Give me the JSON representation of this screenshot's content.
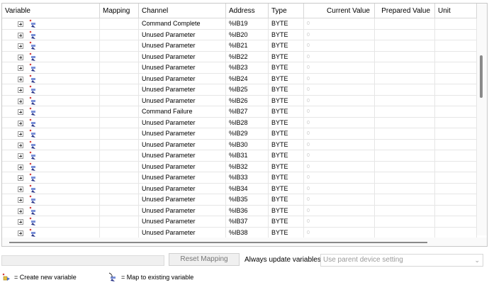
{
  "columns": {
    "variable": "Variable",
    "mapping": "Mapping",
    "channel": "Channel",
    "address": "Address",
    "type": "Type",
    "current_value": "Current Value",
    "prepared_value": "Prepared Value",
    "unit": "Unit"
  },
  "rows": [
    {
      "channel": "Command Complete",
      "address": "%IB19",
      "type": "BYTE",
      "current_value": "0"
    },
    {
      "channel": "Unused Parameter",
      "address": "%IB20",
      "type": "BYTE",
      "current_value": "0"
    },
    {
      "channel": "Unused Parameter",
      "address": "%IB21",
      "type": "BYTE",
      "current_value": "0"
    },
    {
      "channel": "Unused Parameter",
      "address": "%IB22",
      "type": "BYTE",
      "current_value": "0"
    },
    {
      "channel": "Unused Parameter",
      "address": "%IB23",
      "type": "BYTE",
      "current_value": "0"
    },
    {
      "channel": "Unused Parameter",
      "address": "%IB24",
      "type": "BYTE",
      "current_value": "0"
    },
    {
      "channel": "Unused Parameter",
      "address": "%IB25",
      "type": "BYTE",
      "current_value": "0"
    },
    {
      "channel": "Unused Parameter",
      "address": "%IB26",
      "type": "BYTE",
      "current_value": "0"
    },
    {
      "channel": "Command Failure",
      "address": "%IB27",
      "type": "BYTE",
      "current_value": "0"
    },
    {
      "channel": "Unused Parameter",
      "address": "%IB28",
      "type": "BYTE",
      "current_value": "0"
    },
    {
      "channel": "Unused Parameter",
      "address": "%IB29",
      "type": "BYTE",
      "current_value": "0"
    },
    {
      "channel": "Unused Parameter",
      "address": "%IB30",
      "type": "BYTE",
      "current_value": "0"
    },
    {
      "channel": "Unused Parameter",
      "address": "%IB31",
      "type": "BYTE",
      "current_value": "0"
    },
    {
      "channel": "Unused Parameter",
      "address": "%IB32",
      "type": "BYTE",
      "current_value": "0"
    },
    {
      "channel": "Unused Parameter",
      "address": "%IB33",
      "type": "BYTE",
      "current_value": "0"
    },
    {
      "channel": "Unused Parameter",
      "address": "%IB34",
      "type": "BYTE",
      "current_value": "0"
    },
    {
      "channel": "Unused Parameter",
      "address": "%IB35",
      "type": "BYTE",
      "current_value": "0"
    },
    {
      "channel": "Unused Parameter",
      "address": "%IB36",
      "type": "BYTE",
      "current_value": "0"
    },
    {
      "channel": "Unused Parameter",
      "address": "%IB37",
      "type": "BYTE",
      "current_value": "0"
    },
    {
      "channel": "Unused Parameter",
      "address": "%IB38",
      "type": "BYTE",
      "current_value": "0"
    }
  ],
  "bottom": {
    "reset_mapping_label": "Reset Mapping",
    "always_update_label": "Always update variables",
    "setting_value": "Use parent device setting"
  },
  "legend": {
    "create_new": "= Create new variable",
    "map_existing": "= Map to existing variable"
  },
  "icons": {
    "expand": "plus-box-icon",
    "row_variable": "variable-icon",
    "legend_create": "create-variable-icon",
    "legend_map": "map-variable-icon",
    "dropdown": "chevron-down-icon"
  }
}
